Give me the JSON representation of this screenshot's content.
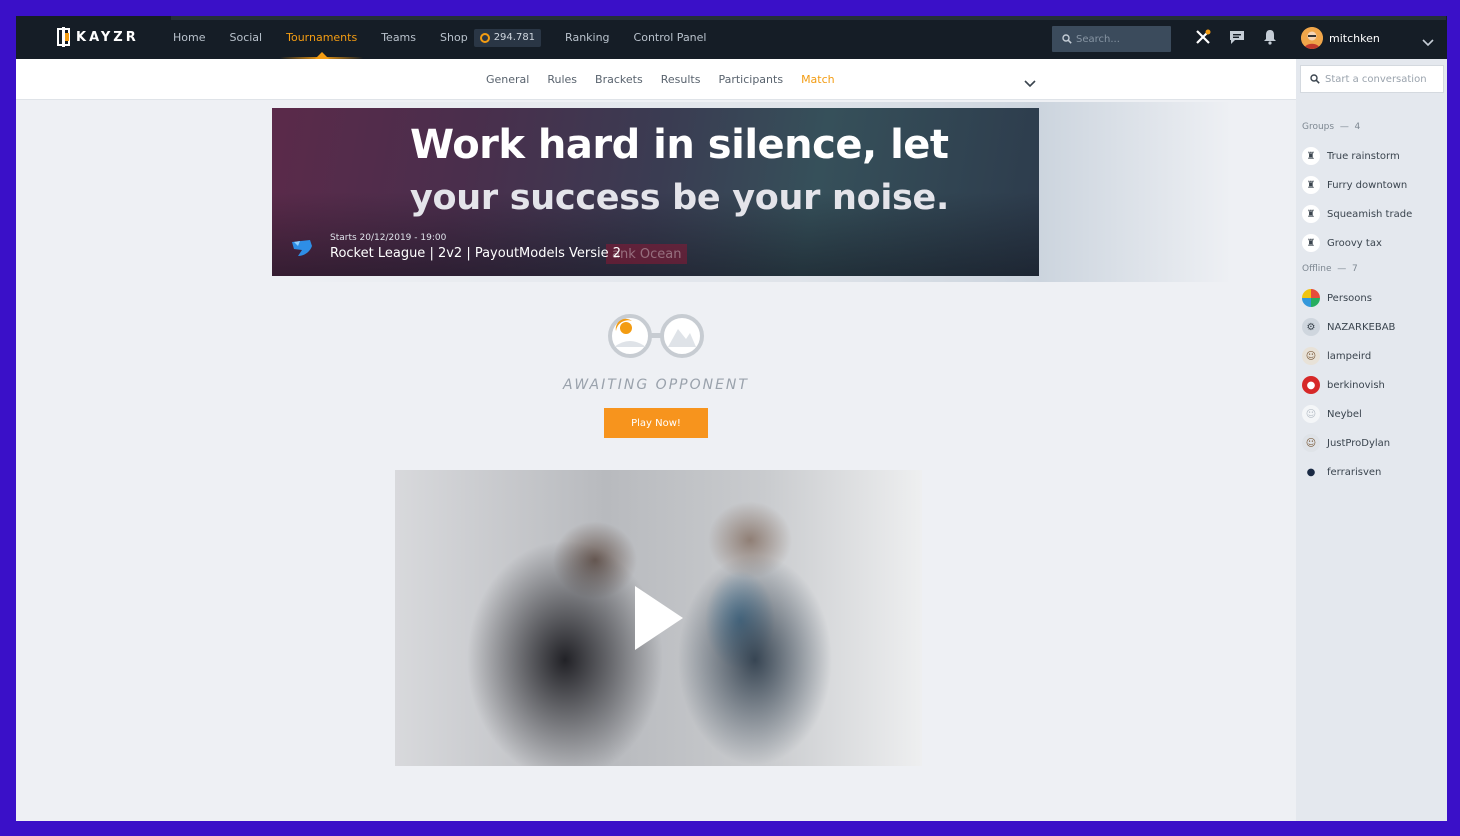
{
  "brand": {
    "name": "KAYZR"
  },
  "nav": {
    "items": [
      {
        "label": "Home",
        "active": false
      },
      {
        "label": "Social",
        "active": false
      },
      {
        "label": "Tournaments",
        "active": true
      },
      {
        "label": "Teams",
        "active": false
      },
      {
        "label": "Shop",
        "active": false
      },
      {
        "label": "Ranking",
        "active": false
      },
      {
        "label": "Control Panel",
        "active": false
      }
    ],
    "coins": "294.781",
    "search_placeholder": "Search...",
    "icons": [
      "tools-icon",
      "chat-icon",
      "bell-icon"
    ]
  },
  "user": {
    "name": "mitchken"
  },
  "subnav": {
    "items": [
      {
        "label": "General",
        "active": false
      },
      {
        "label": "Rules",
        "active": false
      },
      {
        "label": "Brackets",
        "active": false
      },
      {
        "label": "Results",
        "active": false
      },
      {
        "label": "Participants",
        "active": false
      },
      {
        "label": "Match",
        "active": true
      }
    ]
  },
  "banner": {
    "quote_line1": "Work hard in silence, let",
    "quote_line2": "your success be your noise.",
    "starts": "Starts 20/12/2019 - 19:00",
    "title": "Rocket League | 2v2 | PayoutModels Versie 2",
    "overlay_text": "ank Ocean"
  },
  "match": {
    "status": "AWAITING OPPONENT",
    "play_label": "Play Now!"
  },
  "sidebar": {
    "conversation_placeholder": "Start a conversation",
    "groups_label": "Groups",
    "groups_count": "4",
    "groups": [
      {
        "name": "True rainstorm"
      },
      {
        "name": "Furry downtown"
      },
      {
        "name": "Squeamish trade"
      },
      {
        "name": "Groovy tax"
      }
    ],
    "offline_label": "Offline",
    "offline_count": "7",
    "offline": [
      {
        "name": "Persoons"
      },
      {
        "name": "NAZARKEBAB"
      },
      {
        "name": "lampeird"
      },
      {
        "name": "berkinovish"
      },
      {
        "name": "Neybel"
      },
      {
        "name": "JustProDylan"
      },
      {
        "name": "ferrarisven"
      }
    ]
  },
  "colors": {
    "accent": "#f39c12",
    "navbar": "#151d26",
    "frame": "#3a10c8"
  }
}
